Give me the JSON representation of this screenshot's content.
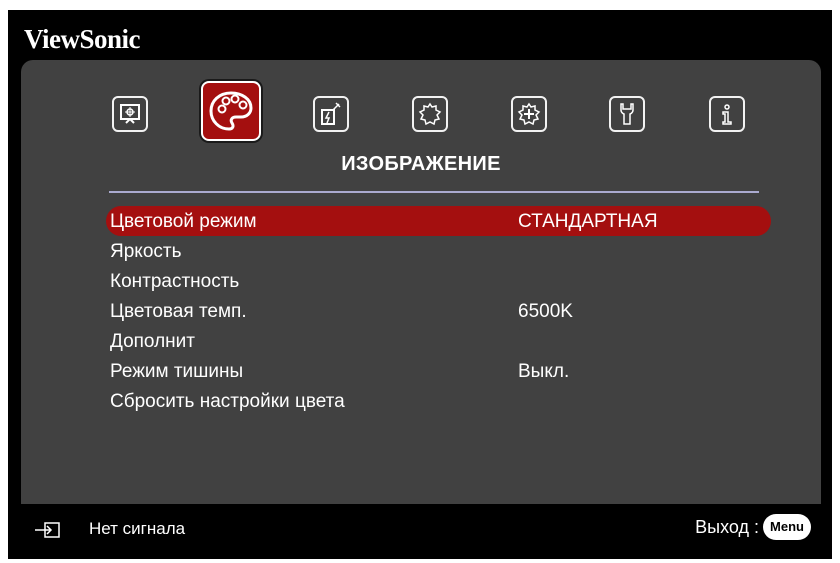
{
  "brand": "ViewSonic",
  "tabs": [
    {
      "icon": "display-icon",
      "active": false
    },
    {
      "icon": "palette-icon",
      "active": true
    },
    {
      "icon": "power-source-icon",
      "active": false
    },
    {
      "icon": "gear-icon",
      "active": false
    },
    {
      "icon": "gear-plus-icon",
      "active": false
    },
    {
      "icon": "wrench-icon",
      "active": false
    },
    {
      "icon": "info-icon",
      "active": false
    }
  ],
  "section_title": "ИЗОБРАЖЕНИЕ",
  "menu": [
    {
      "label": "Цветовой режим",
      "value": "СТАНДАРТНАЯ",
      "selected": true
    },
    {
      "label": "Яркость",
      "value": ""
    },
    {
      "label": "Контрастность",
      "value": ""
    },
    {
      "label": "Цветовая темп.",
      "value": "6500K"
    },
    {
      "label": "Дополнит",
      "value": ""
    },
    {
      "label": "Режим тишины",
      "value": "Выкл."
    },
    {
      "label": "Сбросить настройки цвета",
      "value": ""
    }
  ],
  "footer": {
    "source_icon": "input-source-icon",
    "status": "Нет сигнала",
    "exit_label": "Выход :",
    "menu_key": "Menu"
  },
  "colors": {
    "accent": "#a40f0f",
    "panel": "#414141",
    "divider": "#ababd0"
  }
}
